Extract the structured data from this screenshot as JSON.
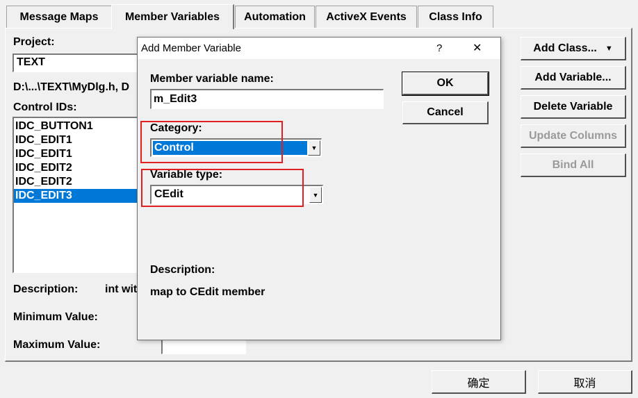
{
  "tabs": [
    {
      "label": "Message Maps"
    },
    {
      "label": "Member Variables"
    },
    {
      "label": "Automation"
    },
    {
      "label": "ActiveX Events"
    },
    {
      "label": "Class Info"
    }
  ],
  "left": {
    "project_label": "Project:",
    "project_value": "TEXT",
    "path_text": "D:\\...\\TEXT\\MyDlg.h, D",
    "control_ids_label": "Control IDs:",
    "control_ids": [
      "IDC_BUTTON1",
      "IDC_EDIT1",
      "IDC_EDIT1",
      "IDC_EDIT2",
      "IDC_EDIT2",
      "IDC_EDIT3"
    ],
    "selected_index": 5,
    "description_label": "Description:",
    "description_value": "int wit",
    "min_label": "Minimum Value:",
    "max_label": "Maximum Value:"
  },
  "right_buttons": {
    "add_class": "Add Class...",
    "add_variable": "Add Variable...",
    "delete_variable": "Delete Variable",
    "update_columns": "Update Columns",
    "bind_all": "Bind All"
  },
  "dialog": {
    "title": "Add Member Variable",
    "help_glyph": "?",
    "close_glyph": "✕",
    "name_label": "Member variable name:",
    "name_value": "m_Edit3",
    "ok": "OK",
    "cancel": "Cancel",
    "category_label": "Category:",
    "category_value": "Control",
    "vartype_label": "Variable type:",
    "vartype_value": "CEdit",
    "description_label": "Description:",
    "description_value": "map to CEdit member"
  },
  "footer": {
    "ok": "确定",
    "cancel": "取消"
  },
  "colors": {
    "selection": "#0078d7",
    "highlight_box": "#e02020"
  }
}
